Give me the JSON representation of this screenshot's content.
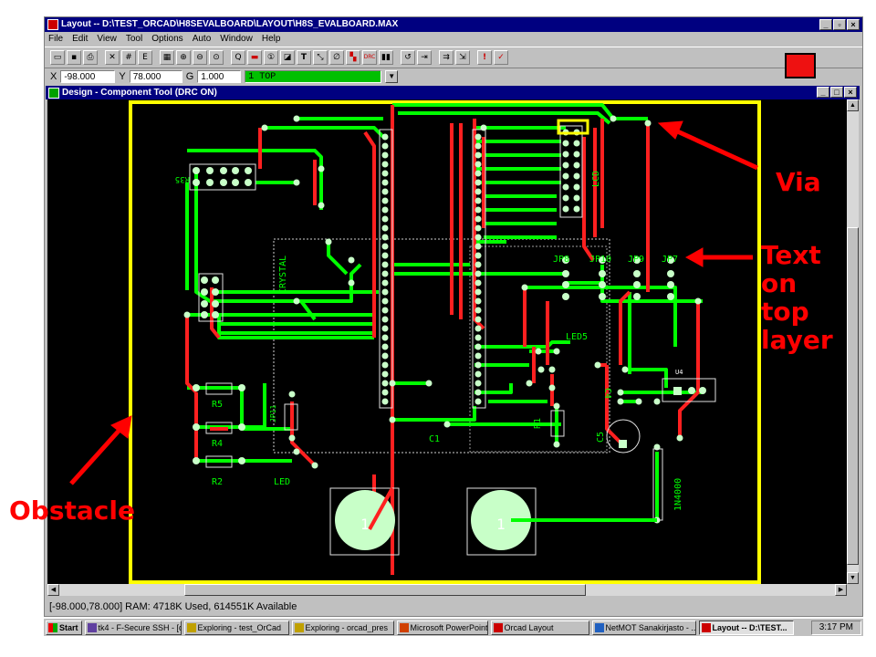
{
  "app": {
    "title": "Layout -- D:\\TEST_ORCAD\\H8SEVALBOARD\\LAYOUT\\H8S_EVALBOARD.MAX",
    "menu": [
      "File",
      "Edit",
      "View",
      "Tool",
      "Options",
      "Auto",
      "Window",
      "Help"
    ],
    "toolbar_icons": [
      "open-icon",
      "save-icon",
      "print-icon",
      "cut-icon",
      "find-icon",
      "edit-icon",
      "grid-icon",
      "zoom-in-icon",
      "zoom-out-icon",
      "zoom-all-icon",
      "query-icon",
      "component-icon",
      "pad-icon",
      "obstacle-icon",
      "text-icon",
      "connection-icon",
      "error-icon",
      "color-icon",
      "drc-icon",
      "batch-icon",
      "reconnect-icon",
      "autoroute-icon",
      "cleanup-icon",
      "online-drc-icon",
      "check-icon"
    ],
    "accent_color": "#ee1111"
  },
  "coords": {
    "x_label": "X",
    "x_value": "-98.000",
    "y_label": "Y",
    "y_value": "78.000",
    "g_label": "G",
    "g_value": "1.000",
    "layer": "1 TOP"
  },
  "design_window": {
    "title": "Design - Component Tool (DRC ON)"
  },
  "pcb": {
    "labels": [
      "R35",
      "LCD",
      "CRYSTAL",
      "JP8",
      "JP10",
      "JP9",
      "JP7",
      "LED5",
      "R5",
      "R4",
      "R2",
      "LED",
      "C1",
      "C5",
      "R1",
      "U4",
      "C4",
      "1N4000",
      "JP11",
      "1",
      "1"
    ],
    "colors": {
      "trace_top": "#00ff00",
      "trace_bottom": "#ff2020",
      "board_outline": "#ffff00",
      "pad": "#c8ffc8"
    }
  },
  "annotations": {
    "via": "Via",
    "text_on_top_layer": "Text on top layer",
    "obstacle": "Obstacle"
  },
  "status": "[-98.000,78.000]   RAM: 4718K Used, 614551K Available",
  "taskbar": {
    "start": "Start",
    "tasks": [
      "tk4 - F-Secure SSH - [d...",
      "Exploring - test_OrCad",
      "Exploring - orcad_pres",
      "Microsoft PowerPoint - ...",
      "Orcad Layout",
      "NetMOT Sanakirjasto - ...",
      "Layout -- D:\\TEST..."
    ],
    "clock": "3:17 PM"
  }
}
